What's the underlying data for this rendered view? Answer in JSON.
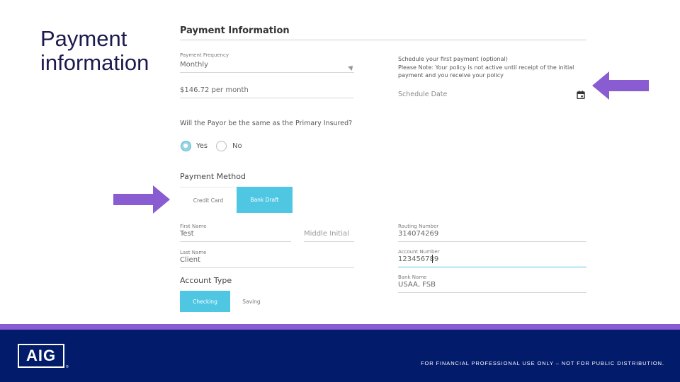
{
  "slide": {
    "title": "Payment\ninformation"
  },
  "form": {
    "heading": "Payment Information",
    "payment_frequency": {
      "label": "Payment Frequency",
      "value": "Monthly"
    },
    "amount": {
      "value": "$146.72 per month"
    },
    "schedule": {
      "note": "Schedule your first payment (optional)\nPlease Note: Your policy is not active until receipt of the initial payment and you receive your policy",
      "date_placeholder": "Schedule Date"
    },
    "payor_question": "Will the Payor be the same as the Primary Insured?",
    "payor_options": [
      {
        "label": "Yes",
        "selected": true
      },
      {
        "label": "No",
        "selected": false
      }
    ],
    "payment_method": {
      "heading": "Payment Method",
      "options": [
        {
          "label": "Credit Card",
          "selected": false
        },
        {
          "label": "Bank Draft",
          "selected": true
        }
      ]
    },
    "first_name": {
      "label": "First Name",
      "value": "Test"
    },
    "middle_initial": {
      "placeholder": "Middle Initial"
    },
    "last_name": {
      "label": "Last Name",
      "value": "Client"
    },
    "routing_number": {
      "label": "Routing Number",
      "value": "314074269"
    },
    "account_number": {
      "label": "Account Number",
      "value": "123456789"
    },
    "bank_name": {
      "label": "Bank Name",
      "value": "USAA, FSB"
    },
    "account_type": {
      "heading": "Account Type",
      "options": [
        {
          "label": "Checking",
          "selected": true
        },
        {
          "label": "Saving",
          "selected": false
        }
      ]
    }
  },
  "footer": {
    "logo": "AIG",
    "disclaimer": "FOR FINANCIAL PROFESSIONAL USE ONLY – NOT FOR PUBLIC DISTRIBUTION."
  },
  "colors": {
    "accent": "#4fc7e3",
    "arrow": "#8a5cd1",
    "footer": "#021b6b"
  },
  "icons": [
    "calendar-icon",
    "dropdown-caret-icon",
    "arrow-right-icon",
    "arrow-left-icon"
  ]
}
